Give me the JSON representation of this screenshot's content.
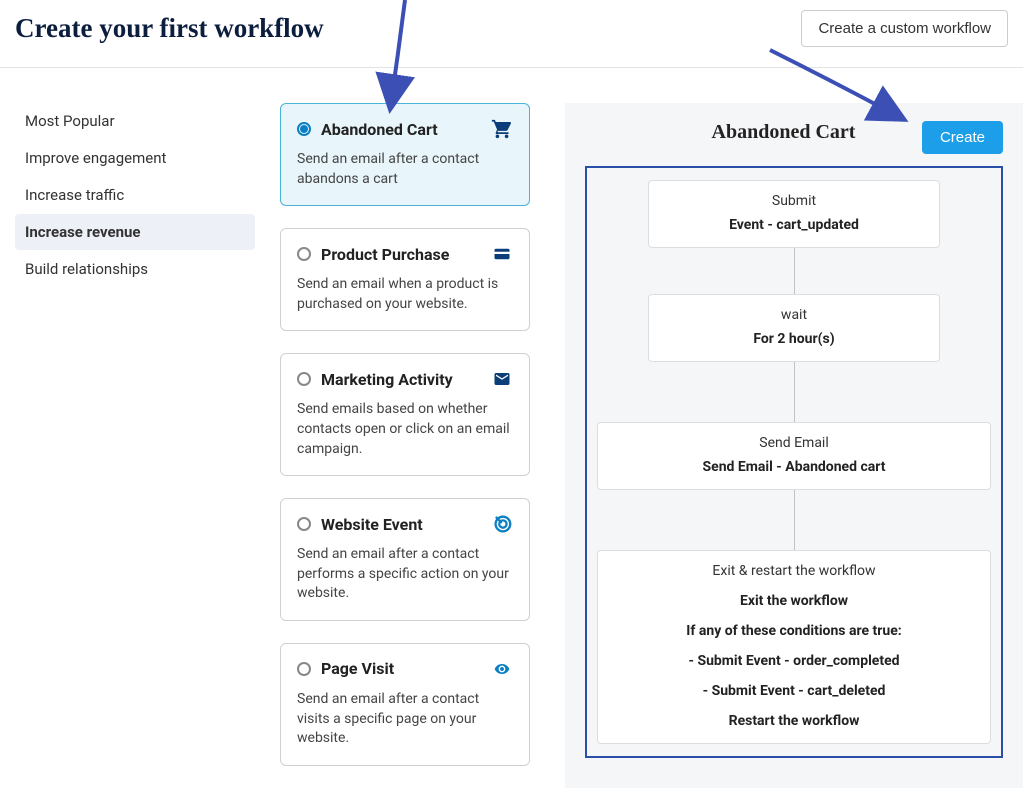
{
  "header": {
    "title": "Create your first workflow",
    "custom_btn": "Create a custom workflow"
  },
  "sidebar": {
    "items": [
      {
        "label": "Most Popular",
        "active": false
      },
      {
        "label": "Improve engagement",
        "active": false
      },
      {
        "label": "Increase traffic",
        "active": false
      },
      {
        "label": "Increase revenue",
        "active": true
      },
      {
        "label": "Build relationships",
        "active": false
      }
    ]
  },
  "templates": [
    {
      "title": "Abandoned Cart",
      "desc": "Send an email after a contact abandons a cart",
      "icon": "cart",
      "selected": true
    },
    {
      "title": "Product Purchase",
      "desc": "Send an email when a product is purchased on your website.",
      "icon": "card",
      "selected": false
    },
    {
      "title": "Marketing Activity",
      "desc": "Send emails based on whether contacts open or click on an email campaign.",
      "icon": "mail",
      "selected": false
    },
    {
      "title": "Website Event",
      "desc": "Send an email after a contact performs a specific action on your website.",
      "icon": "target",
      "selected": false
    },
    {
      "title": "Page Visit",
      "desc": "Send an email after a contact visits a specific page on your website.",
      "icon": "eye",
      "selected": false
    }
  ],
  "preview": {
    "title": "Abandoned Cart",
    "create_btn": "Create",
    "nodes": {
      "submit": {
        "top": "Submit",
        "main": "Event - cart_updated"
      },
      "wait": {
        "top": "wait",
        "main": "For 2 hour(s)"
      },
      "send": {
        "top": "Send Email",
        "main": "Send Email - Abandoned cart"
      },
      "exit": {
        "top": "Exit & restart the workflow",
        "line1": "Exit the workflow",
        "line2": "If any of these conditions are true:",
        "line3": "- Submit Event - order_completed",
        "line4": "- Submit Event - cart_deleted",
        "line5": "Restart the workflow"
      }
    }
  }
}
